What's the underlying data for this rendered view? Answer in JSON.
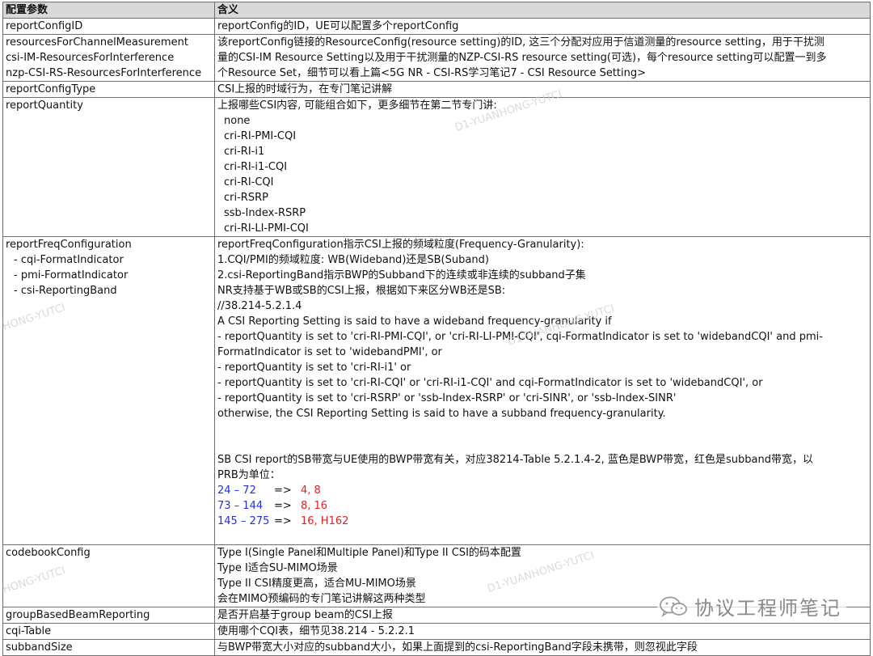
{
  "table": {
    "header": {
      "param": "配置参数",
      "meaning": "含义"
    },
    "rows": {
      "reportConfigID": {
        "param": "reportConfigID",
        "meaning": "reportConfig的ID，UE可以配置多个reportConfig"
      },
      "resources": {
        "params": [
          "resourcesForChannelMeasurement",
          "csi-IM-ResourcesForInterference",
          "nzp-CSI-RS-ResourcesForInterference"
        ],
        "meaning": [
          "该reportConfig链接的ResourceConfig(resource setting)的ID, 这三个分配对应用于信道测量的resource setting，用于干扰测",
          "量的CSI-IM Resource Setting以及用于干扰测量的NZP-CSI-RS resource setting(可选)，每个resource setting可以配置一到多",
          "个Resource Set，细节可以看上篇<5G NR - CSI-RS学习笔记7 - CSI Resource Setting>"
        ]
      },
      "reportConfigType": {
        "param": "reportConfigType",
        "meaning": "CSI上报的时域行为，在专门笔记讲解"
      },
      "reportQuantity": {
        "param": "reportQuantity",
        "intro": "上报哪些CSI内容, 可能组合如下，更多细节在第二节专门讲:",
        "options": [
          "none",
          "cri-RI-PMI-CQI",
          "cri-RI-i1",
          "cri-RI-i1-CQI",
          "cri-RI-CQI",
          "cri-RSRP",
          "ssb-Index-RSRP",
          "cri-RI-LI-PMI-CQI"
        ]
      },
      "reportFreqConfiguration": {
        "params": [
          "reportFreqConfiguration",
          "- cqi-FormatIndicator",
          "- pmi-FormatIndicator",
          "- csi-ReportingBand"
        ],
        "lines": [
          "reportFreqConfiguration指示CSI上报的频域粒度(Frequency-Granularity):",
          "1.CQI/PMI的频域粒度: WB(Wideband)还是SB(Suband)",
          "2.csi-ReportingBand指示BWP的Subband下的连续或非连续的subband子集",
          "NR支持基于WB或SB的CSI上报，根据如下来区分WB还是SB:",
          "//38.214-5.2.1.4",
          "A CSI Reporting Setting is said to have a wideband frequency-granularity if",
          "- reportQuantity is set to 'cri-RI-PMI-CQI', or 'cri-RI-LI-PMI-CQI', cqi-FormatIndicator is set to 'widebandCQI' and pmi-",
          "FormatIndicator is set to 'widebandPMI', or",
          "- reportQuantity is set to 'cri-RI-i1' or",
          "- reportQuantity is set to 'cri-RI-CQI' or 'cri-RI-i1-CQI' and cqi-FormatIndicator is set to 'widebandCQI', or",
          "- reportQuantity is set to 'cri-RSRP' or 'ssb-Index-RSRP' or 'cri-SINR', or 'ssb-Index-SINR'",
          "otherwise, the CSI Reporting Setting is said to have a subband frequency-granularity."
        ],
        "sb_lines": [
          "SB CSI report的SB带宽与UE使用的BWP带宽有关，对应38214-Table 5.2.1.4-2, 蓝色是BWP带宽，红色是subband带宽，以",
          "PRB为单位："
        ],
        "mapping": [
          {
            "bwp": "24 – 72",
            "arrow": "=>",
            "subband": "4, 8"
          },
          {
            "bwp": "73 – 144",
            "arrow": "=>",
            "subband": "8, 16"
          },
          {
            "bwp": "145 – 275",
            "arrow": "=>",
            "subband": "16, H162"
          }
        ]
      },
      "codebookConfig": {
        "param": "codebookConfig",
        "lines": [
          "Type I(Single Panel和Multiple Panel)和Type II CSI的码本配置",
          "Type I适合SU-MIMO场景",
          "Type II CSI精度更高，适合MU-MIMO场景",
          "会在MIMO预编码的专门笔记讲解这两种类型"
        ]
      },
      "groupBasedBeamReporting": {
        "param": "groupBasedBeamReporting",
        "meaning": "是否开启基于group beam的CSI上报"
      },
      "cqiTable": {
        "param": "cqi-Table",
        "meaning": "使用哪个CQI表，细节见38.214 - 5.2.2.1"
      },
      "subbandSize": {
        "param": "subbandSize",
        "meaning": "与BWP带宽大小对应的subband大小，如果上面提到的csi-ReportingBand字段未携带，则忽视此字段"
      }
    }
  },
  "colors": {
    "bwp": "#2232d6",
    "subband": "#e02222",
    "header_bg": "#d9d9d9",
    "border": "#6f6f6f"
  },
  "watermark": {
    "text_right": "D1-YUANHONG-YUTCI",
    "text_left": "HONG-YUTCI"
  },
  "brand": {
    "icon": "wechat-logo-icon",
    "text": "协议工程师笔记"
  }
}
